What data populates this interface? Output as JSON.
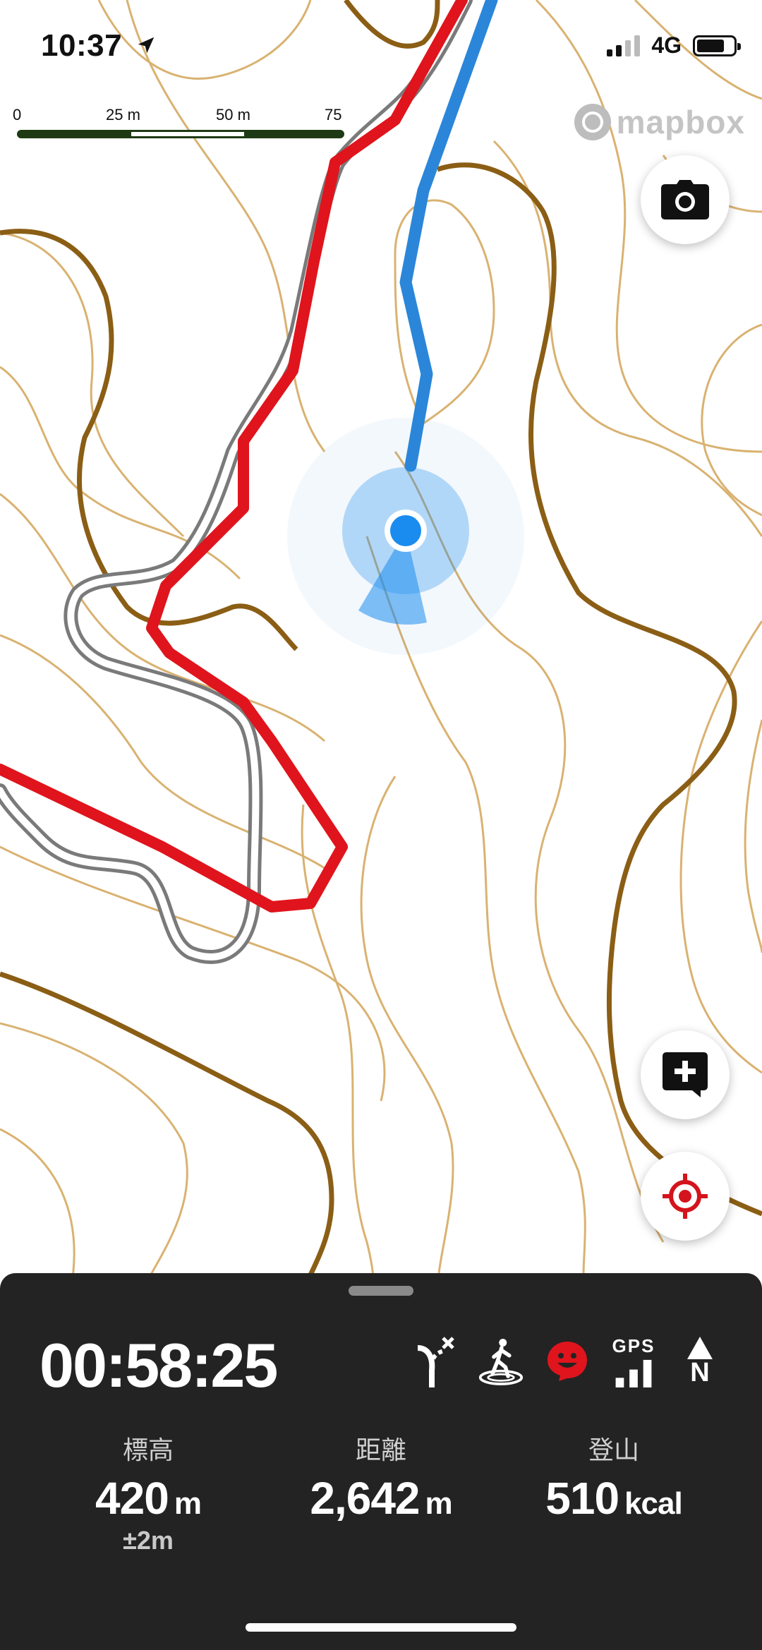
{
  "status_bar": {
    "time": "10:37",
    "network": "4G"
  },
  "map": {
    "scale_labels": [
      "0",
      "25 m",
      "50 m",
      "75 m"
    ],
    "attribution": "mapbox",
    "colors": {
      "contour_major": "#8b5e15",
      "contour_minor": "#d9b271",
      "recorded_track": "#e0141c",
      "planned_route": "#2b86d9",
      "trail": "#7a7a7a",
      "location_dot": "#1a8cf0"
    }
  },
  "buttons": {
    "camera": "camera-icon",
    "add_memo": "add-comment-icon",
    "locate": "target-icon"
  },
  "panel": {
    "elapsed_time": "00:58:25",
    "status_icons": [
      "route-deviation-icon",
      "walking-person-icon",
      "smile-face-icon",
      "gps-signal-icon",
      "north-up-icon"
    ],
    "gps_label": "GPS",
    "north_label": "N",
    "stats": [
      {
        "label": "標高",
        "value": "420",
        "unit": "m",
        "sub": "±2m"
      },
      {
        "label": "距離",
        "value": "2,642",
        "unit": "m"
      },
      {
        "label": "登山",
        "value": "510",
        "unit": "kcal"
      }
    ]
  }
}
